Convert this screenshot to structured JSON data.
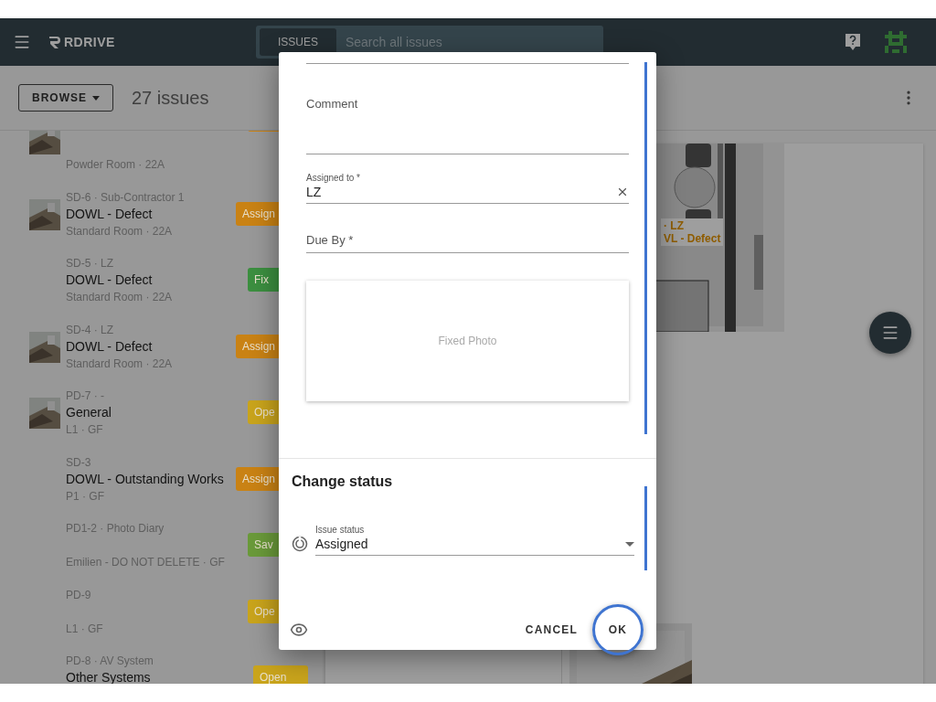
{
  "header": {
    "brand": "RDRIVE",
    "search_scope": "ISSUES",
    "search_placeholder": "Search all issues"
  },
  "toolbar": {
    "browse_label": "BROWSE",
    "issue_count": "27 issues"
  },
  "issues": [
    {
      "subtitle": "Powder Room · 22A",
      "color": "#c98214",
      "thumbnail": true
    },
    {
      "code": "SD-6 · Sub-Contractor 1",
      "title": "DOWL - Defect",
      "subtitle": "Standard Room · 22A",
      "color": "#c98214",
      "badge": "Assign",
      "thumbnail": true
    },
    {
      "code": "SD-5 · LZ",
      "title": "DOWL - Defect",
      "subtitle": "Standard Room · 22A",
      "color": "#3c8f40",
      "badge": "Fix",
      "thumbnail": false
    },
    {
      "code": "SD-4 · LZ",
      "title": "DOWL - Defect",
      "subtitle": "Standard Room · 22A",
      "color": "#c98214",
      "badge": "Assign",
      "thumbnail": true
    },
    {
      "code": "PD-7 · -",
      "title": "General",
      "subtitle": "L1 · GF",
      "color": "#c9a41c",
      "badge": "Ope",
      "thumbnail": true
    },
    {
      "code": "SD-3",
      "title": "DOWL - Outstanding Works",
      "subtitle": "P1 · GF",
      "color": "#c98214",
      "badge": "Assign",
      "thumbnail": false
    },
    {
      "code": "PD1-2 · Photo Diary",
      "subtitle": "Emilien - DO NOT DELETE · GF",
      "color": "#6a9a3a",
      "badge": "Sav",
      "thumbnail": false
    },
    {
      "code": "PD-9",
      "subtitle": "L1 · GF",
      "color": "#c9a41c",
      "badge": "Ope",
      "thumbnail": false
    },
    {
      "code": "PD-8 · AV System",
      "title": "Other Systems",
      "color": "#c9a41c",
      "badge": "Open",
      "thumbnail": false
    }
  ],
  "plan": {
    "pin_code": "· LZ",
    "pin_title": "VL - Defect"
  },
  "dialog": {
    "comment_label": "Comment",
    "assigned_label": "Assigned to *",
    "assigned_value": "LZ",
    "due_label": "Due By *",
    "photo_label": "Fixed Photo",
    "section_title": "Change status",
    "status_label": "Issue status",
    "status_value": "Assigned",
    "cancel": "CANCEL",
    "ok": {
      "label": "OK",
      "highlighted": true
    }
  }
}
